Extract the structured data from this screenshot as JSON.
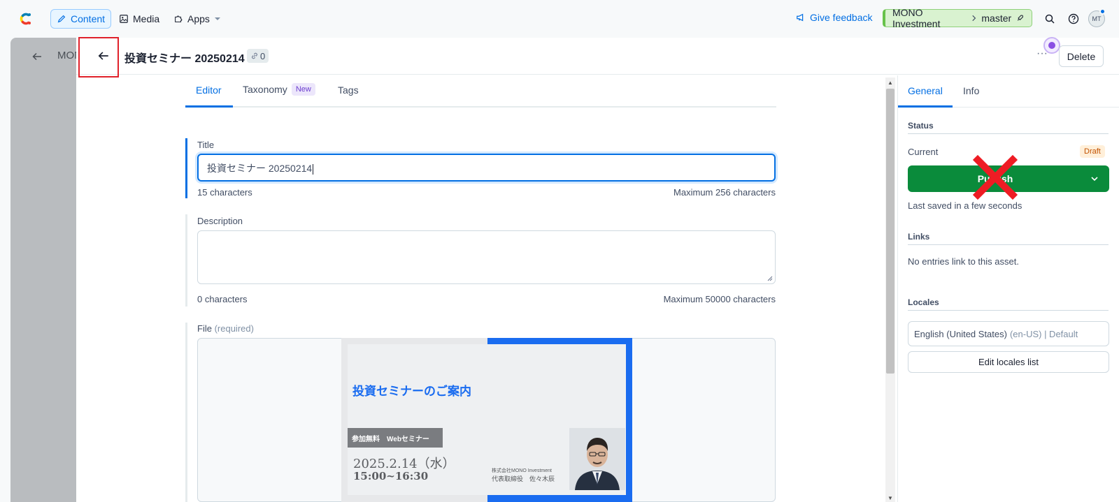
{
  "nav": {
    "items": [
      {
        "label": "Content",
        "icon": "pencil-icon",
        "active": true
      },
      {
        "label": "Media",
        "icon": "image-icon"
      },
      {
        "label": "Apps",
        "icon": "puzzle-icon"
      }
    ],
    "feedback": "Give feedback",
    "space": "MONO Investment",
    "environment": "master",
    "avatar_initials": "MT"
  },
  "background": {
    "breadcrumb": "MON"
  },
  "asset": {
    "title": "投資セミナー 20250214",
    "references_count": "0",
    "delete_label": "Delete",
    "more_label": "···"
  },
  "tabs": {
    "editor": "Editor",
    "taxonomy": "Taxonomy",
    "taxonomy_badge": "New",
    "tags": "Tags"
  },
  "fields": {
    "title": {
      "label": "Title",
      "value": "投資セミナー 20250214",
      "count": "15 characters",
      "max": "Maximum 256 characters"
    },
    "description": {
      "label": "Description",
      "value": "",
      "count": "0 characters",
      "max": "Maximum 50000 characters"
    },
    "file": {
      "label": "File",
      "required": "(required)"
    }
  },
  "slide": {
    "heading": "投資セミナーのご案内",
    "tag": "参加無料　Webセミナー",
    "date": "2025.2.14（水）",
    "time": "15:00~16:30",
    "company": "株式会社MONO Investment",
    "ceo": "代表取締役　佐々木辰"
  },
  "sidebar": {
    "tabs": [
      "General",
      "Info"
    ],
    "status_heading": "Status",
    "current_label": "Current",
    "status_badge": "Draft",
    "publish_label": "Publish",
    "last_saved": "Last saved in a few seconds",
    "links_heading": "Links",
    "links_text": "No entries link to this asset.",
    "locales_heading": "Locales",
    "locale": "English (United States)",
    "locale_code": "(en-US) | Default",
    "edit_locales": "Edit locales list"
  },
  "colors": {
    "accent": "#036fe3",
    "publish": "#0a8b3b",
    "annotation": "#e0212a"
  }
}
